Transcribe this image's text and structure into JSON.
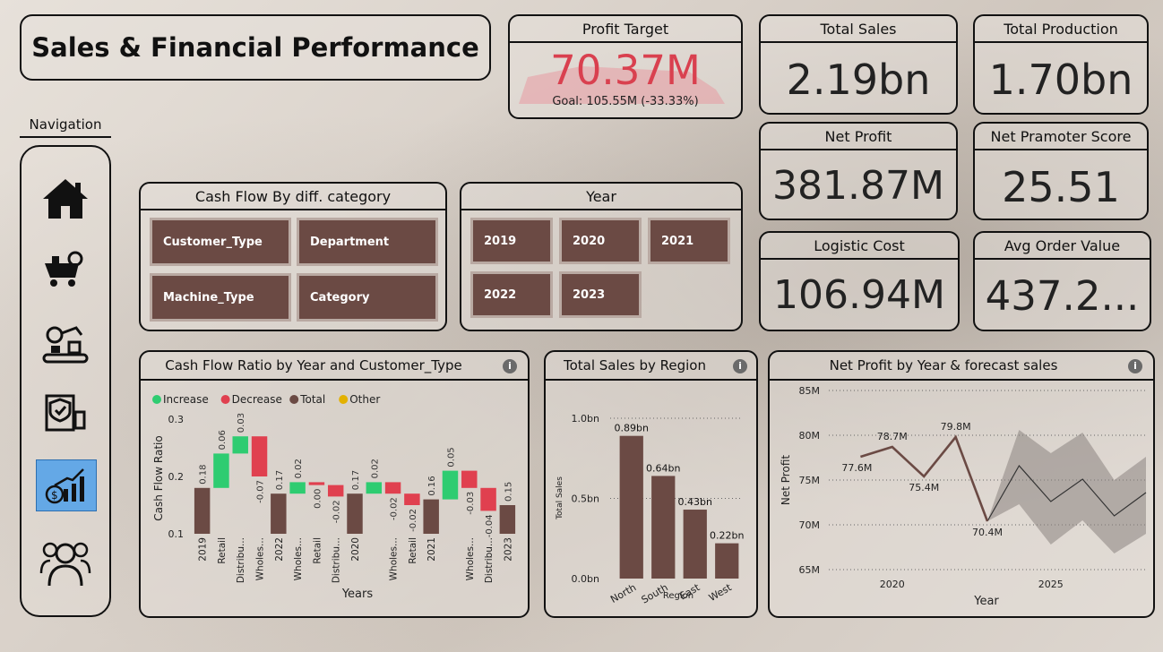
{
  "header": {
    "title": "Sales & Financial Performance"
  },
  "navigation": {
    "label": "Navigation",
    "items": [
      {
        "name": "home-icon"
      },
      {
        "name": "production-cart-icon"
      },
      {
        "name": "factory-conveyor-icon"
      },
      {
        "name": "security-report-icon"
      },
      {
        "name": "financial-chart-icon",
        "active": true
      },
      {
        "name": "people-group-icon"
      }
    ]
  },
  "kpis": {
    "profit_target": {
      "title": "Profit Target",
      "value": "70.37M",
      "goal": "Goal: 105.55M (-33.33%)",
      "color": "#d9404f"
    },
    "total_sales": {
      "title": "Total Sales",
      "value": "2.19bn"
    },
    "total_production": {
      "title": "Total Production",
      "value": "1.70bn"
    },
    "net_profit": {
      "title": "Net Profit",
      "value": "381.87M"
    },
    "nps": {
      "title": "Net Pramoter Score",
      "value": "25.51"
    },
    "logistic_cost": {
      "title": "Logistic Cost",
      "value": "106.94M"
    },
    "aov": {
      "title": "Avg Order Value",
      "value": "437.2..."
    }
  },
  "cashflow_category": {
    "title": "Cash Flow By diff. category",
    "buttons": [
      "Customer_Type",
      "Department",
      "Machine_Type",
      "Category"
    ]
  },
  "year_slicer": {
    "title": "Year",
    "buttons": [
      "2019",
      "2020",
      "2021",
      "2022",
      "2023"
    ]
  },
  "colors": {
    "accent": "#6b4a44",
    "increase": "#2ecc71",
    "decrease": "#e0404f",
    "total": "#6b4a44",
    "other": "#e3b100"
  },
  "chart_data": [
    {
      "type": "bar",
      "subtype": "waterfall",
      "title": "Cash Flow Ratio by Year and Customer_Type",
      "xlabel": "Years",
      "ylabel": "Cash Flow Ratio",
      "ylim": [
        0.1,
        0.3
      ],
      "yticks": [
        "0.1",
        "0.2",
        "0.3"
      ],
      "legend": [
        "Increase",
        "Decrease",
        "Total",
        "Other"
      ],
      "legend_position": "top-left",
      "categories": [
        "2019",
        "Retail",
        "Distribu...",
        "Wholes...",
        "2022",
        "Wholes...",
        "Retail",
        "Distribu...",
        "2020",
        "Wholes...",
        "Retail",
        "2021",
        "Wholes...",
        "Distribu...",
        "2023"
      ],
      "kinds": [
        "total",
        "increase",
        "increase",
        "decrease",
        "total",
        "increase",
        "decrease",
        "decrease",
        "total",
        "increase",
        "decrease",
        "total",
        "increase",
        "decrease",
        "decrease",
        "total"
      ],
      "steps": [
        {
          "label": "2019",
          "kind": "total",
          "value": 0.18,
          "text": "0.18"
        },
        {
          "label": "Retail",
          "kind": "increase",
          "value": 0.06,
          "text": "0.06"
        },
        {
          "label": "Distribu...",
          "kind": "increase",
          "value": 0.03,
          "text": "0.03"
        },
        {
          "label": "Wholes...",
          "kind": "decrease",
          "value": -0.07,
          "text": "-0.07"
        },
        {
          "label": "2022",
          "kind": "total",
          "value": 0.17,
          "text": "0.17"
        },
        {
          "label": "Wholes...",
          "kind": "increase",
          "value": 0.02,
          "text": "0.02"
        },
        {
          "label": "Retail",
          "kind": "decrease",
          "value": -0.005,
          "text": "0.00"
        },
        {
          "label": "Distribu...",
          "kind": "decrease",
          "value": -0.02,
          "text": "-0.02"
        },
        {
          "label": "2020",
          "kind": "total",
          "value": 0.17,
          "text": "0.17"
        },
        {
          "label": "",
          "kind": "increase",
          "value": 0.02,
          "text": "0.02"
        },
        {
          "label": "Wholes...",
          "kind": "decrease",
          "value": -0.02,
          "text": "-0.02"
        },
        {
          "label": "Retail",
          "kind": "decrease",
          "value": -0.02,
          "text": "-0.02"
        },
        {
          "label": "2021",
          "kind": "total",
          "value": 0.16,
          "text": "0.16"
        },
        {
          "label": "",
          "kind": "increase",
          "value": 0.05,
          "text": "0.05"
        },
        {
          "label": "Wholes...",
          "kind": "decrease",
          "value": -0.03,
          "text": "-0.03"
        },
        {
          "label": "Distribu...",
          "kind": "decrease",
          "value": -0.04,
          "text": "-0.04"
        },
        {
          "label": "2023",
          "kind": "total",
          "value": 0.15,
          "text": "0.15"
        }
      ]
    },
    {
      "type": "bar",
      "title": "Total Sales by Region",
      "xlabel": "Region",
      "ylabel": "Total Sales",
      "ylim": [
        0,
        1.0
      ],
      "yticks": [
        "0.0bn",
        "0.5bn",
        "1.0bn"
      ],
      "categories": [
        "North",
        "South",
        "East",
        "West"
      ],
      "values": [
        0.89,
        0.64,
        0.43,
        0.22
      ],
      "labels": [
        "0.89bn",
        "0.64bn",
        "0.43bn",
        "0.22bn"
      ]
    },
    {
      "type": "line",
      "title": "Net Profit by Year & forecast sales",
      "xlabel": "Year",
      "ylabel": "Net Profit",
      "ylim": [
        65,
        85
      ],
      "yticks": [
        "65M",
        "70M",
        "75M",
        "80M",
        "85M"
      ],
      "xticks": [
        "2020",
        "2025"
      ],
      "xrange": [
        2018,
        2028
      ],
      "x": [
        2019,
        2020,
        2021,
        2022,
        2023
      ],
      "values": [
        77.6,
        78.7,
        75.4,
        79.8,
        70.4
      ],
      "labels": [
        "77.6M",
        "78.7M",
        "75.4M",
        "79.8M",
        "70.4M"
      ],
      "forecast": {
        "x": [
          2023,
          2024,
          2025,
          2026,
          2027
        ],
        "values": [
          70.4,
          76.6,
          72.6,
          75.1,
          71.0,
          73.6
        ],
        "x_full": [
          2023,
          2024,
          2025,
          2026,
          2027,
          2028
        ],
        "upper": [
          70.4,
          80.6,
          78.0,
          80.3,
          75.0,
          77.6
        ],
        "lower": [
          70.4,
          72.3,
          67.8,
          70.5,
          66.8,
          69.0
        ]
      }
    }
  ]
}
